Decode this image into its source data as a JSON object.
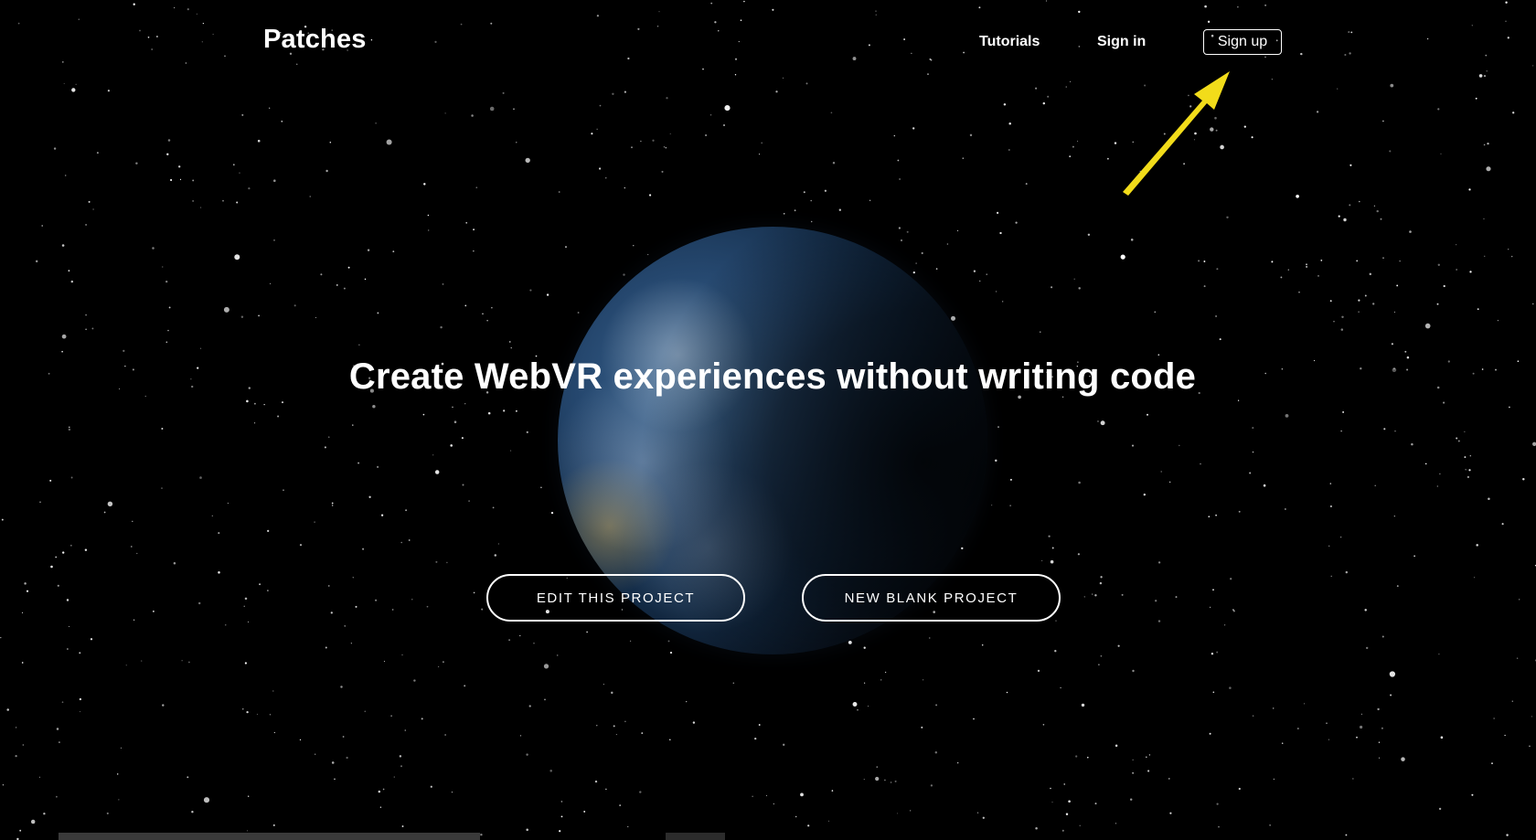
{
  "header": {
    "logo": "Patches",
    "nav": {
      "tutorials": "Tutorials",
      "signin": "Sign in",
      "signup": "Sign up"
    }
  },
  "hero": {
    "headline": "Create WebVR experiences without writing code",
    "buttons": {
      "edit": "EDIT THIS PROJECT",
      "new": "NEW BLANK PROJECT"
    }
  },
  "colors": {
    "background": "#000000",
    "text": "#ffffff",
    "annotation_arrow": "#f2dc1a"
  },
  "icons": {
    "annotation": "arrow-pointer-icon"
  }
}
